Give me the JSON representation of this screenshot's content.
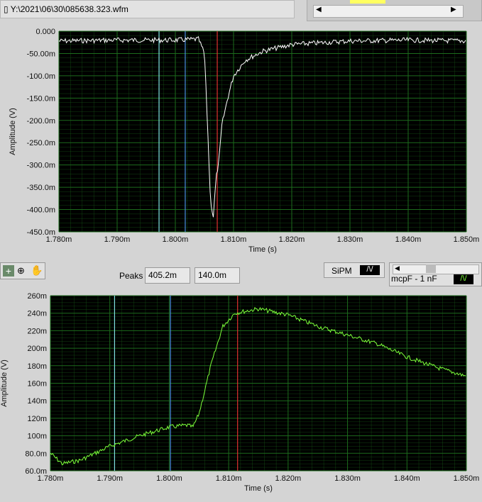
{
  "file_path": "Y:\\2021\\06\\30\\085638.323.wfm",
  "peaks": {
    "label": "Peaks",
    "values": [
      "405.2m",
      "140.0m"
    ]
  },
  "legend": {
    "plot1": "SiPM",
    "plot2": "mcpF - 1 nF"
  },
  "toolbar": {
    "icons": [
      "cursor-move-icon",
      "zoom-icon",
      "pan-hand-icon"
    ]
  },
  "colors": {
    "plot_bg": "#000000",
    "grid": "#1c6b1c",
    "trace1": "#ffffff",
    "trace2": "#7cff3a",
    "cursor_cyan": "#7fe0e0",
    "cursor_blue": "#4a8fe0",
    "cursor_red": "#e03030"
  },
  "chart_data": [
    {
      "type": "line",
      "xlabel": "Time (s)",
      "ylabel": "Amplitude (V)",
      "xlim": [
        0.00178,
        0.00185
      ],
      "ylim": [
        -0.45,
        0
      ],
      "xticks": [
        "1.780m",
        "1.790m",
        "1.800m",
        "1.810m",
        "1.820m",
        "1.830m",
        "1.840m",
        "1.850m"
      ],
      "yticks": [
        "0.000",
        "-50.00m",
        "-100.0m",
        "-150.0m",
        "-200.0m",
        "-250.0m",
        "-300.0m",
        "-350.0m",
        "-400.0m",
        "-450.0m"
      ],
      "grid": true,
      "cursors": [
        0.0017972,
        0.0018017,
        0.0018072
      ],
      "x": [
        0.00178,
        0.00179,
        0.0018,
        0.001804,
        0.001805,
        0.0018055,
        0.001806,
        0.0018065,
        0.001807,
        0.0018075,
        0.001808,
        0.001809,
        0.00181,
        0.001812,
        0.001815,
        0.00182,
        0.00183,
        0.00184,
        0.00185
      ],
      "y": [
        -0.022,
        -0.02,
        -0.02,
        -0.018,
        -0.05,
        -0.2,
        -0.37,
        -0.42,
        -0.33,
        -0.29,
        -0.21,
        -0.15,
        -0.1,
        -0.065,
        -0.045,
        -0.03,
        -0.022,
        -0.02,
        -0.022
      ]
    },
    {
      "type": "line",
      "xlabel": "Time (s)",
      "ylabel": "Amplitude (V)",
      "xlim": [
        0.00178,
        0.00185
      ],
      "ylim": [
        0.06,
        0.26
      ],
      "xticks": [
        "1.780m",
        "1.790m",
        "1.800m",
        "1.810m",
        "1.820m",
        "1.830m",
        "1.840m",
        "1.850m"
      ],
      "yticks": [
        "260m",
        "240m",
        "220m",
        "200m",
        "180m",
        "160m",
        "140m",
        "120m",
        "100m",
        "80.0m",
        "60.0m"
      ],
      "grid": true,
      "cursors": [
        0.0017908,
        0.0018002,
        0.0018115
      ],
      "x": [
        0.00178,
        0.001782,
        0.001785,
        0.00179,
        0.001795,
        0.0018,
        0.001803,
        0.001804,
        0.001805,
        0.001807,
        0.001809,
        0.001811,
        0.001815,
        0.00182,
        0.001825,
        0.00183,
        0.001835,
        0.00184,
        0.001845,
        0.00185
      ],
      "y": [
        0.08,
        0.068,
        0.072,
        0.088,
        0.1,
        0.11,
        0.112,
        0.11,
        0.125,
        0.18,
        0.225,
        0.24,
        0.245,
        0.238,
        0.225,
        0.215,
        0.205,
        0.19,
        0.178,
        0.168
      ]
    }
  ]
}
